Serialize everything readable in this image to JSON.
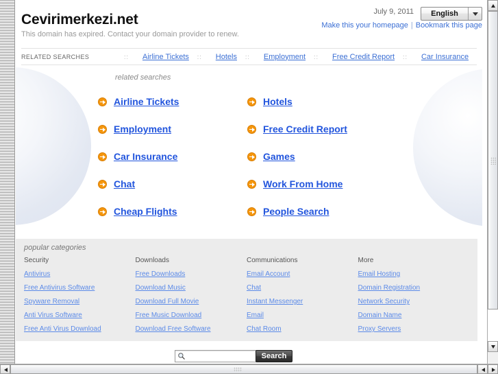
{
  "header": {
    "site_title": "Cevirimerkezi.net",
    "expired_note": "This domain has expired. Contact your domain provider to renew.",
    "date": "July 9, 2011",
    "language": "English",
    "make_homepage": "Make this your homepage",
    "bookmark": "Bookmark this page",
    "pipe": "|"
  },
  "related_bar": {
    "label": "RELATED SEARCHES",
    "separator": "::",
    "links": [
      "Airline Tickets",
      "Hotels",
      "Employment",
      "Free Credit Report",
      "Car Insurance"
    ]
  },
  "related_main": {
    "heading": "related searches",
    "left_column": [
      "Airline Tickets",
      "Employment",
      "Car Insurance",
      "Chat",
      "Cheap Flights"
    ],
    "right_column": [
      "Hotels",
      "Free Credit Report",
      "Games",
      "Work From Home",
      "People Search"
    ]
  },
  "categories": {
    "heading": "popular categories",
    "columns": [
      {
        "title": "Security",
        "links": [
          "Antivirus",
          "Free Antivirus Software",
          "Spyware Removal",
          "Anti Virus Software",
          "Free Anti Virus Download"
        ]
      },
      {
        "title": "Downloads",
        "links": [
          "Free Downloads",
          "Download Music",
          "Download Full Movie",
          "Free Music Download",
          "Download Free Software"
        ]
      },
      {
        "title": "Communications",
        "links": [
          "Email Account",
          "Chat",
          "Instant Messenger",
          "Email",
          "Chat Room"
        ]
      },
      {
        "title": "More",
        "links": [
          "Email Hosting",
          "Domain Registration",
          "Network Security",
          "Domain Name",
          "Proxy Servers"
        ]
      }
    ]
  },
  "search": {
    "value": "",
    "placeholder": "",
    "button_label": "Search",
    "icon": "magnifier-icon"
  },
  "colors": {
    "link_blue": "#3b6fd4",
    "big_link_blue": "#2255dd",
    "arrow_orange": "#f5960c",
    "category_bg": "#ececec",
    "muted_text": "#999999"
  },
  "icons": {
    "arrow_circle": "arrow-circle-right-icon",
    "dropdown": "chevron-down-icon",
    "scroll_up": "triangle-up-icon",
    "scroll_down": "triangle-down-icon",
    "scroll_left": "triangle-left-icon",
    "scroll_right": "triangle-right-icon"
  }
}
